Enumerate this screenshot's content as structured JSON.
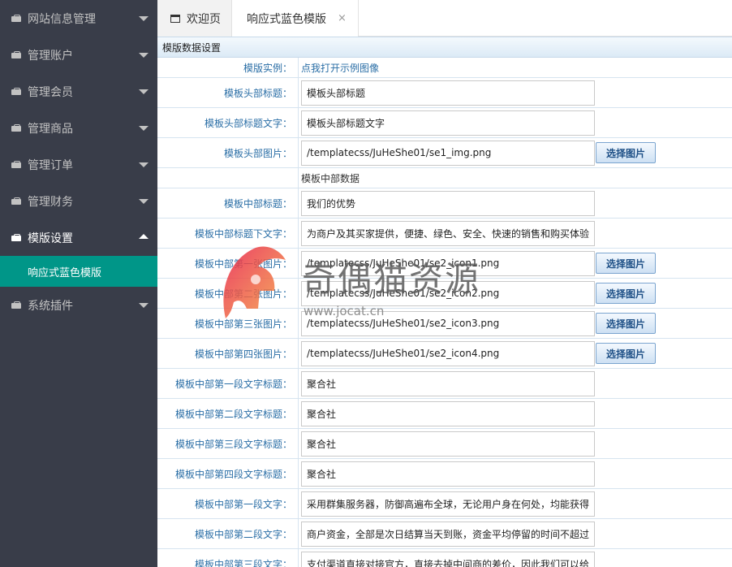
{
  "sidebar": {
    "items": [
      {
        "label": "网站信息管理"
      },
      {
        "label": "管理账户"
      },
      {
        "label": "管理会员"
      },
      {
        "label": "管理商品"
      },
      {
        "label": "管理订单"
      },
      {
        "label": "管理财务"
      },
      {
        "label": "模版设置"
      },
      {
        "label": "系统插件"
      }
    ],
    "active_sub": "响应式蓝色模版"
  },
  "tabs": {
    "home": "欢迎页",
    "active": "响应式蓝色模版",
    "close": "×"
  },
  "panel": {
    "title": "模版数据设置",
    "button_label": "选择图片",
    "rows": [
      {
        "label": "模版实例：",
        "value": "点我打开示例图像"
      },
      {
        "label": "模板头部标题：",
        "value": "模板头部标题"
      },
      {
        "label": "模板头部标题文字：",
        "value": "模板头部标题文字"
      },
      {
        "label": "模板头部图片：",
        "value": "/templatecss/JuHeShe01/se1_img.png"
      },
      {
        "label": "",
        "value": "模板中部数据"
      },
      {
        "label": "模板中部标题：",
        "value": "我们的优势"
      },
      {
        "label": "模板中部标题下文字：",
        "value": "为商户及其买家提供，便捷、绿色、安全、快速的销售和购买体验"
      },
      {
        "label": "模板中部第一张图片：",
        "value": "/templatecss/JuHeShe01/se2_icon1.png"
      },
      {
        "label": "模板中部第二张图片：",
        "value": "/templatecss/JuHeShe01/se2_icon2.png"
      },
      {
        "label": "模板中部第三张图片：",
        "value": "/templatecss/JuHeShe01/se2_icon3.png"
      },
      {
        "label": "模板中部第四张图片：",
        "value": "/templatecss/JuHeShe01/se2_icon4.png"
      },
      {
        "label": "模板中部第一段文字标题：",
        "value": "聚合社"
      },
      {
        "label": "模板中部第二段文字标题：",
        "value": "聚合社"
      },
      {
        "label": "模板中部第三段文字标题：",
        "value": "聚合社"
      },
      {
        "label": "模板中部第四段文字标题：",
        "value": "聚合社"
      },
      {
        "label": "模板中部第一段文字：",
        "value": "采用群集服务器，防御高遍布全球，无论用户身在何处，均能获得"
      },
      {
        "label": "模板中部第二段文字：",
        "value": "商户资金，全部是次日结算当天到账，资金平均停留的时间不超过"
      },
      {
        "label": "模板中部第三段文字：",
        "value": "支付渠道直接对接官方，直接去掉中间商的差价，因此我们可以给"
      }
    ]
  },
  "watermark": {
    "text": "奇偶猫资源",
    "url": "www.jocat.cn"
  }
}
